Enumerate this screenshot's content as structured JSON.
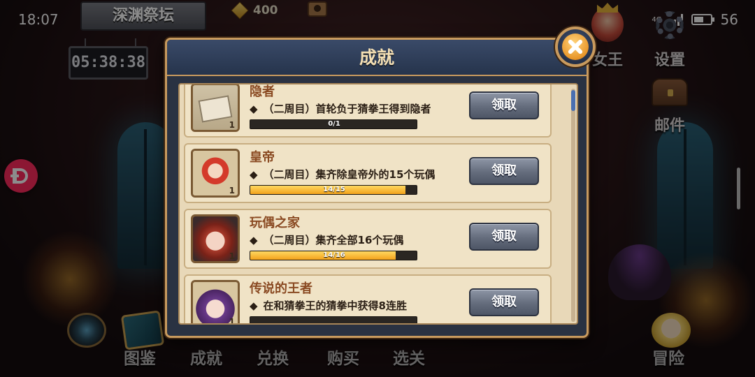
{
  "status_bar": {
    "time": "18:07",
    "network": "4G",
    "battery": "56"
  },
  "hud": {
    "location": "深渊祭坛",
    "timer": "05:38:38",
    "currency_value": "400",
    "queen_label": "女王",
    "settings_label": "设置",
    "mail_label": "邮件"
  },
  "dialog": {
    "title": "成就",
    "items": [
      {
        "title": "隐者",
        "description": "（二周目）首轮负于猜拳王得到隐者",
        "progress_text": "0/1",
        "progress": 0.0,
        "count": "1",
        "claim_label": "领取"
      },
      {
        "title": "皇帝",
        "description": "（二周目）集齐除皇帝外的15个玩偶",
        "progress_text": "14/15",
        "progress": 0.933,
        "count": "1",
        "claim_label": "领取"
      },
      {
        "title": "玩偶之家",
        "description": "（二周目）集齐全部16个玩偶",
        "progress_text": "14/16",
        "progress": 0.875,
        "count": "1",
        "claim_label": "领取"
      },
      {
        "title": "传说的王者",
        "description": "在和猜拳王的猜拳中获得8连胜",
        "progress_text": "",
        "progress": 0.0,
        "count": "1",
        "claim_label": "领取"
      }
    ]
  },
  "bottom_nav": {
    "items": [
      {
        "label": "图鉴"
      },
      {
        "label": "成就"
      },
      {
        "label": "兑换"
      },
      {
        "label": "购买"
      },
      {
        "label": "选关"
      },
      {
        "label": "冒险"
      }
    ]
  },
  "colors": {
    "accent_gold": "#c89a5e",
    "progress_fill": "#f2a21c",
    "badge": "#ff2a5e"
  }
}
